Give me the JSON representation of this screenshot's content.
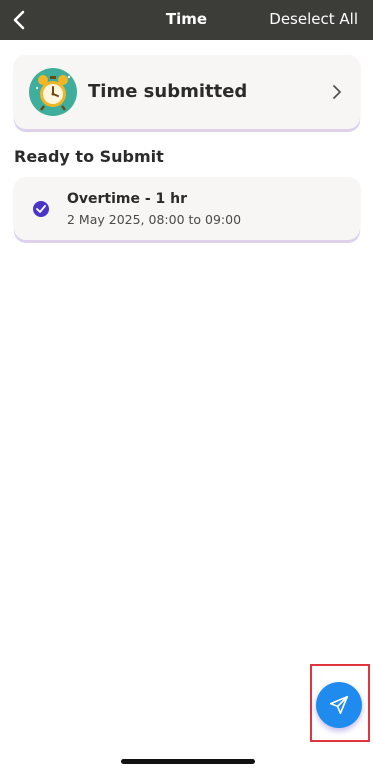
{
  "header": {
    "title": "Time",
    "deselect_label": "Deselect All",
    "background_color": "#3c3c38"
  },
  "submitted_card": {
    "label": "Time submitted",
    "icon": "alarm-clock-icon"
  },
  "ready_section": {
    "heading": "Ready to Submit",
    "items": [
      {
        "title": "Overtime - 1 hr",
        "subtitle": "2 May 2025, 08:00 to 09:00",
        "selected": true
      }
    ]
  },
  "fab": {
    "icon": "send-icon",
    "color": "#1f8bef"
  },
  "accent_color": "#4a35c8",
  "highlight_color": "#e0343f"
}
